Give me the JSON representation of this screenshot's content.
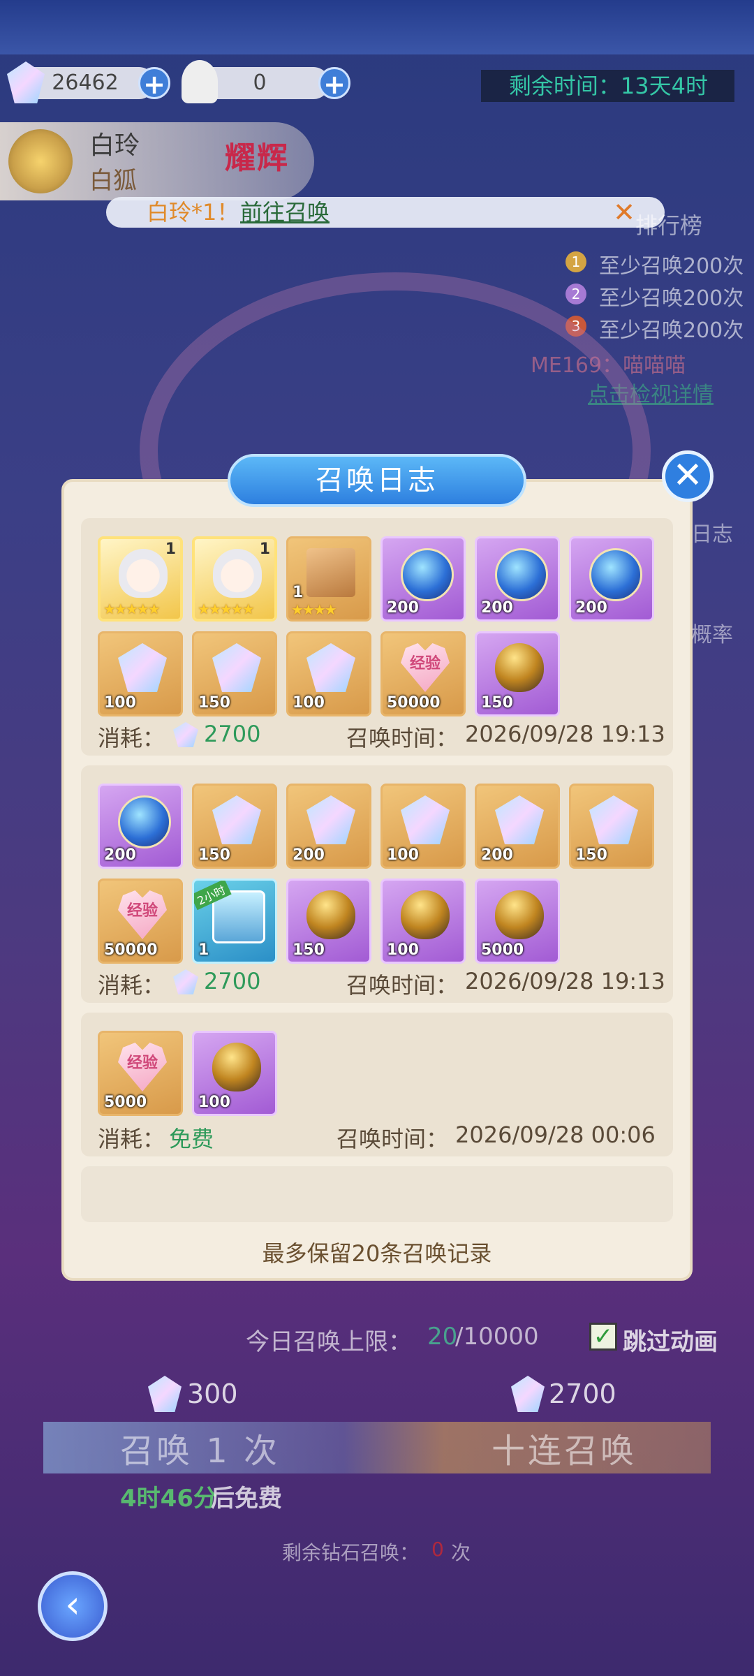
{
  "top": {
    "diamond_count": "26462",
    "ticket_count": "0",
    "timer_text": "剩余时间：13天4时"
  },
  "hero": {
    "name": "白玲",
    "title": "白狐",
    "badge": "耀辉"
  },
  "notice": {
    "text": "白玲*1！",
    "link": "前往召唤",
    "close": "✕"
  },
  "ranking": {
    "title": "排行榜",
    "ranks": [
      {
        "num": "1",
        "text": "至少召唤200次"
      },
      {
        "num": "2",
        "text": "至少召唤200次"
      },
      {
        "num": "3",
        "text": "至少召唤200次"
      }
    ],
    "player": "ME169：喵喵喵",
    "detail_link": "点击检视详情"
  },
  "side": {
    "log_label": "日志",
    "rate_label": "概率"
  },
  "modal": {
    "title": "召唤日志",
    "close": "✕",
    "cost_label": "消耗：",
    "time_label": "召唤时间：",
    "footer": "最多保留20条召唤记录",
    "records": [
      {
        "cost": "2700",
        "time": "2026/09/28 19:13",
        "items": [
          {
            "type": "hero",
            "count": "",
            "level": "1",
            "stars": "★★★★★"
          },
          {
            "type": "hero",
            "count": "",
            "level": "1",
            "stars": "★★★★★"
          },
          {
            "type": "box",
            "count": "1",
            "stars": "★★★★"
          },
          {
            "type": "orb",
            "count": "200"
          },
          {
            "type": "orb",
            "count": "200"
          },
          {
            "type": "orb",
            "count": "200"
          },
          {
            "type": "gem",
            "count": "100"
          },
          {
            "type": "gem",
            "count": "150"
          },
          {
            "type": "gem",
            "count": "100"
          },
          {
            "type": "exp",
            "count": "50000",
            "text": "经验"
          },
          {
            "type": "egg",
            "count": "150"
          }
        ]
      },
      {
        "cost": "2700",
        "time": "2026/09/28 19:13",
        "items": [
          {
            "type": "orb",
            "count": "200"
          },
          {
            "type": "gem",
            "count": "150"
          },
          {
            "type": "gem",
            "count": "200"
          },
          {
            "type": "gem",
            "count": "100"
          },
          {
            "type": "gem",
            "count": "200"
          },
          {
            "type": "gem",
            "count": "150"
          },
          {
            "type": "exp",
            "count": "50000",
            "text": "经验"
          },
          {
            "type": "chest",
            "count": "1",
            "tag": "2小时"
          },
          {
            "type": "egg",
            "count": "150"
          },
          {
            "type": "egg",
            "count": "100"
          },
          {
            "type": "egg",
            "count": "5000"
          }
        ]
      },
      {
        "cost": "免费",
        "time": "2026/09/28 00:06",
        "items": [
          {
            "type": "exp",
            "count": "5000",
            "text": "经验"
          },
          {
            "type": "egg",
            "count": "100"
          }
        ]
      }
    ]
  },
  "bottom": {
    "daily_prefix": "今日召唤上限：",
    "daily_used": "20",
    "daily_total": "/10000",
    "skip_label": "跳过动画",
    "single_cost": "300",
    "ten_cost": "2700",
    "single_label": "召唤 1 次",
    "ten_label": "十连召唤",
    "free_timer": "4时46分",
    "free_suffix": "后免费",
    "remain_prefix": "剩余钻石召唤：",
    "remain_num": "0",
    "remain_suffix": "次"
  },
  "colors": {
    "accent_blue": "#2d7fdf",
    "modal_bg": "#f4ede0",
    "cost_green": "#2e9a5a"
  }
}
